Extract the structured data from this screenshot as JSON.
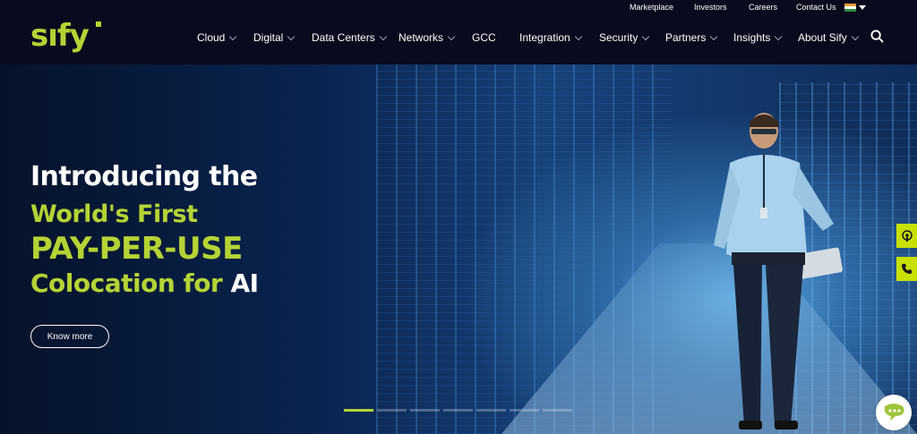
{
  "brand": {
    "logo_text": "sıfy"
  },
  "utility_nav": [
    "Marketplace",
    "Investors",
    "Careers",
    "Contact Us"
  ],
  "main_nav": [
    {
      "label": "Cloud"
    },
    {
      "label": "Digital"
    },
    {
      "label": "Data Centers"
    },
    {
      "label": "Networks"
    },
    {
      "label": "GCC"
    },
    {
      "label": "Integration"
    },
    {
      "label": "Security"
    },
    {
      "label": "Partners"
    },
    {
      "label": "Insights"
    },
    {
      "label": "About Sify"
    }
  ],
  "hero": {
    "line1": "Introducing the",
    "line2": "World's First",
    "line3": "PAY-PER-USE",
    "line4_prefix": "Colocation for ",
    "line4_highlight": "AI",
    "button_label": "Know more"
  },
  "carousel": {
    "slide_count": 7,
    "active_index": 0
  },
  "colors": {
    "accent": "#b5d334",
    "header_bg": "#0a0a1e",
    "side_button": "#c8e000"
  },
  "icons": [
    "search-icon",
    "chevron-down-icon",
    "flag-india-icon",
    "podcast-icon",
    "phone-icon",
    "chat-icon"
  ]
}
